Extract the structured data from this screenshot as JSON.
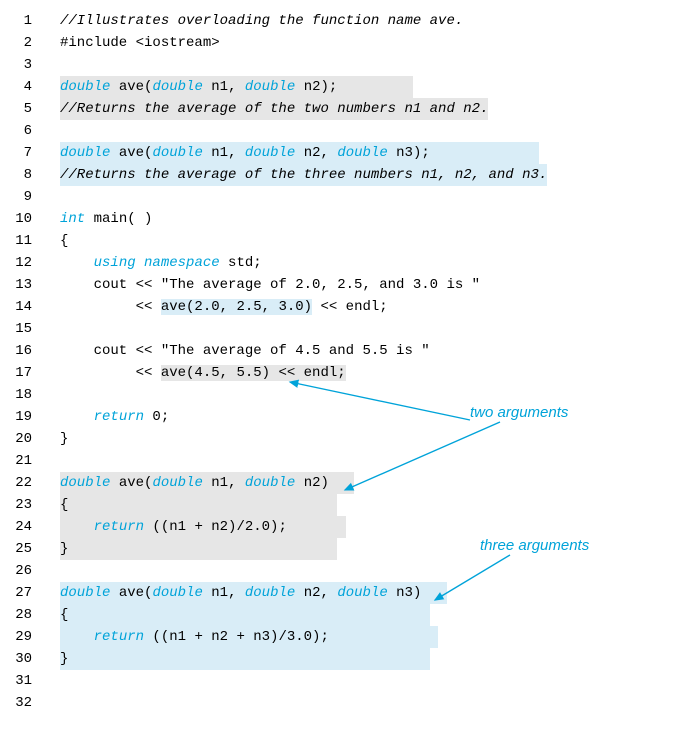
{
  "lines": {
    "l1": "//Illustrates overloading the function name ave.",
    "l2": "#include <iostream>",
    "l3": "",
    "l4_kw1": "double",
    "l4_t1": " ave(",
    "l4_kw2": "double",
    "l4_t2": " n1, ",
    "l4_kw3": "double",
    "l4_t3": " n2);",
    "l5": "//Returns the average of the two numbers n1 and n2.",
    "l6": "",
    "l7_kw1": "double",
    "l7_t1": " ave(",
    "l7_kw2": "double",
    "l7_t2": " n1, ",
    "l7_kw3": "double",
    "l7_t3": " n2, ",
    "l7_kw4": "double",
    "l7_t4": " n3);",
    "l8": "//Returns the average of the three numbers n1, n2, and n3.",
    "l9": "",
    "l10_kw1": "int",
    "l10_t1": " main( )",
    "l11": "{",
    "l12_pad": "    ",
    "l12_kw1": "using",
    "l12_sp": " ",
    "l12_kw2": "namespace",
    "l12_t1": " std;",
    "l13": "    cout << \"The average of 2.0, 2.5, and 3.0 is \"",
    "l14_t1": "         << ",
    "l14_hl": "ave(2.0, 2.5, 3.0)",
    "l14_t2": " << endl;",
    "l15": "",
    "l16": "    cout << \"The average of 4.5 and 5.5 is \"",
    "l17_t1": "         << ",
    "l17_hl": "ave(4.5, 5.5) << endl;",
    "l18": "",
    "l19_pad": "    ",
    "l19_kw1": "return",
    "l19_t1": " 0;",
    "l20": "}",
    "l21": "",
    "l22_kw1": "double",
    "l22_t1": " ave(",
    "l22_kw2": "double",
    "l22_t2": " n1, ",
    "l22_kw3": "double",
    "l22_t3": " n2)",
    "l23": "{",
    "l24_pad": "    ",
    "l24_kw1": "return",
    "l24_t1": " ((n1 + n2)/2.0);",
    "l25": "}",
    "l26": "",
    "l27_kw1": "double",
    "l27_t1": " ave(",
    "l27_kw2": "double",
    "l27_t2": " n1, ",
    "l27_kw3": "double",
    "l27_t3": " n2, ",
    "l27_kw4": "double",
    "l27_t4": " n3)",
    "l28": "{",
    "l29_pad": "    ",
    "l29_kw1": "return",
    "l29_t1": " ((n1 + n2 + n3)/3.0);",
    "l30": "}",
    "l31": "",
    "l32": ""
  },
  "linenos": {
    "n1": "1",
    "n2": "2",
    "n3": "3",
    "n4": "4",
    "n5": "5",
    "n6": "6",
    "n7": "7",
    "n8": "8",
    "n9": "9",
    "n10": "10",
    "n11": "11",
    "n12": "12",
    "n13": "13",
    "n14": "14",
    "n15": "15",
    "n16": "16",
    "n17": "17",
    "n18": "18",
    "n19": "19",
    "n20": "20",
    "n21": "21",
    "n22": "22",
    "n23": "23",
    "n24": "24",
    "n25": "25",
    "n26": "26",
    "n27": "27",
    "n28": "28",
    "n29": "29",
    "n30": "30",
    "n31": "31",
    "n32": "32"
  },
  "annotations": {
    "two_args": "two arguments",
    "three_args": "three arguments"
  }
}
